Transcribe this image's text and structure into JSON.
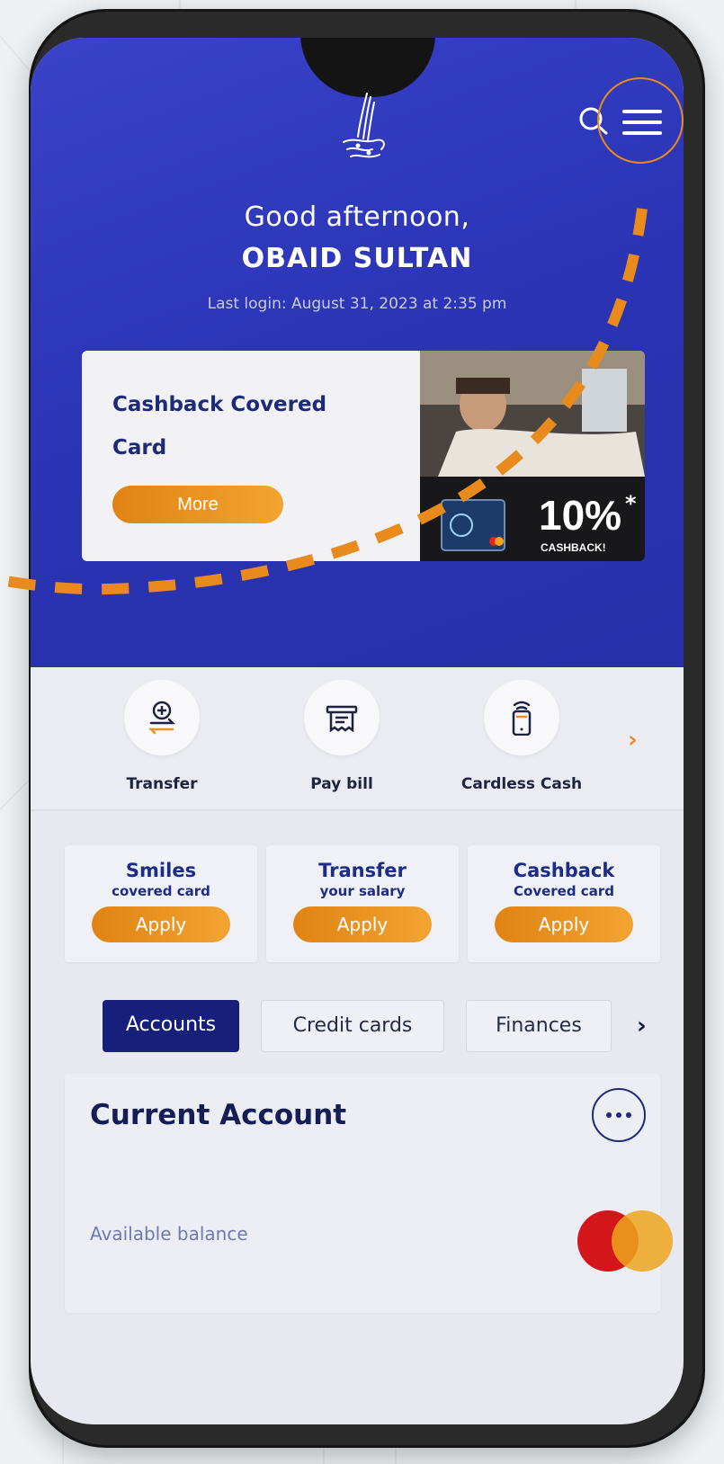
{
  "header": {
    "logo_icon": "calligraphy-logo-icon",
    "search_icon": "search-icon",
    "menu_icon": "hamburger-menu-icon",
    "accent_color": "#e98a1d"
  },
  "greeting": {
    "salutation": "Good afternoon,",
    "name": "OBAID SULTAN",
    "last_login": "Last login: August 31, 2023 at 2:35 pm"
  },
  "promo": {
    "title": "Cashback Covered Card",
    "button_label": "More",
    "image_text_big": "10%",
    "image_text_star": "*",
    "image_text_small": "CASHBACK!"
  },
  "quick_actions": {
    "items": [
      {
        "label": "Transfer",
        "icon": "transfer-icon"
      },
      {
        "label": "Pay bill",
        "icon": "bill-icon"
      },
      {
        "label": "Cardless Cash",
        "icon": "phone-wireless-icon"
      }
    ],
    "next_icon": "chevron-right-icon"
  },
  "offers": [
    {
      "title": "Smiles",
      "subtitle": "covered card",
      "button": "Apply"
    },
    {
      "title": "Transfer",
      "subtitle": "your salary",
      "button": "Apply"
    },
    {
      "title": "Cashback",
      "subtitle": "Covered card",
      "button": "Apply"
    }
  ],
  "tabs": {
    "items": [
      {
        "label": "Accounts",
        "active": true
      },
      {
        "label": "Credit cards",
        "active": false
      },
      {
        "label": "Finances",
        "active": false
      }
    ],
    "next_icon": "chevron-right-icon"
  },
  "account": {
    "title": "Current Account",
    "balance_label": "Available balance",
    "more_icon": "more-options-icon",
    "card_brand_icon": "mastercard-icon"
  },
  "colors": {
    "hero_blue": "#2b35b6",
    "navy": "#16207a",
    "orange": "#e98a1d"
  }
}
